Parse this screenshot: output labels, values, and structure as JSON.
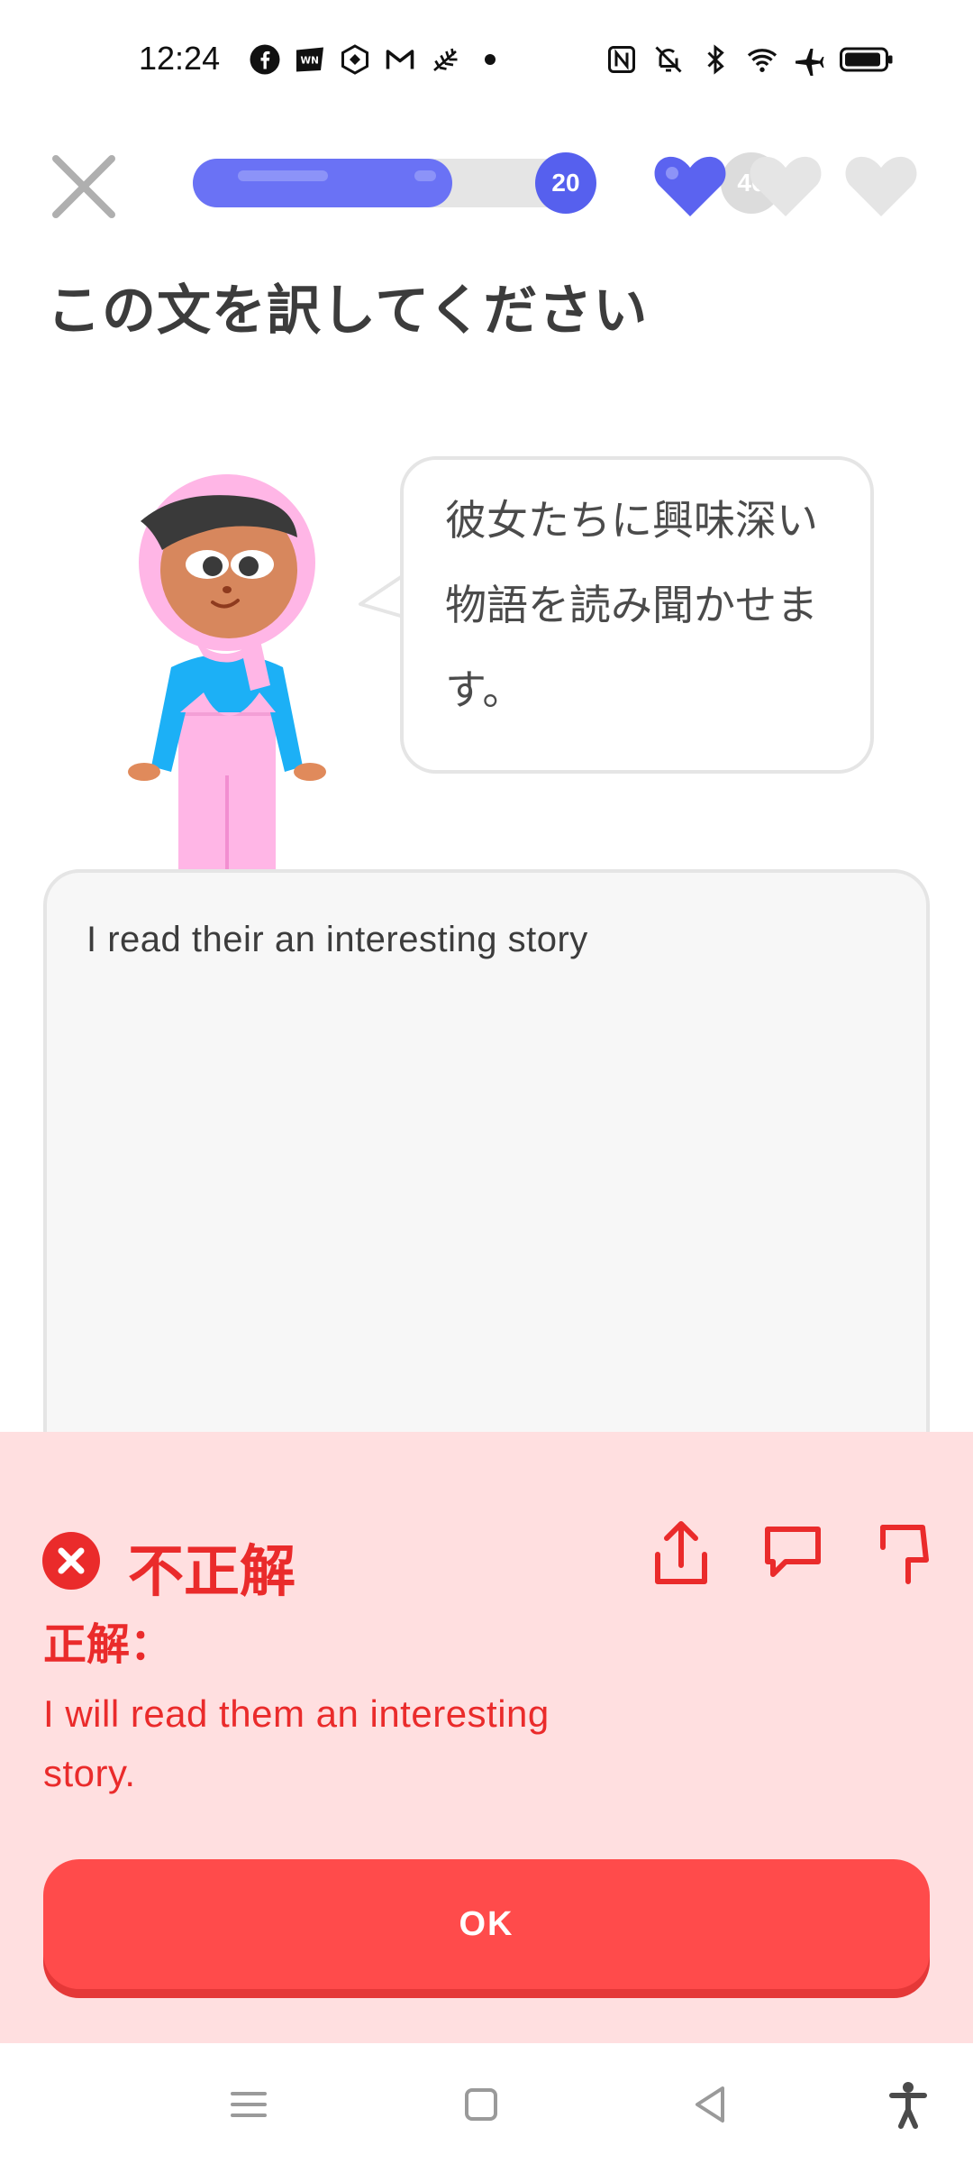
{
  "status_bar": {
    "time": "12:24",
    "left_icons": [
      "facebook-icon",
      "webtoon-icon",
      "sync-app-icon",
      "gmail-icon",
      "wheat-app-icon",
      "dot-icon"
    ],
    "right_icons": [
      "nfc-icon",
      "mute-icon",
      "bluetooth-icon",
      "wifi-icon",
      "airplane-icon",
      "battery-icon"
    ]
  },
  "header": {
    "progress": {
      "current_label": "20",
      "next_label": "40",
      "fraction": 0.66
    },
    "hearts": {
      "filled": 1,
      "total": 3
    }
  },
  "exercise": {
    "title": "この文を訳してください",
    "prompt_sentence": "彼女たちに興味深い物語を読み聞かせます。",
    "user_answer": "I read their an interesting story"
  },
  "feedback": {
    "title": "不正解",
    "correct_label": "正解：",
    "correct_answer": "I will read them an interesting story.",
    "ok_label": "OK"
  },
  "colors": {
    "accent": "#6a72f5",
    "error": "#ea2b2b",
    "error_bg": "#ffdfe0",
    "ok_button": "#ff4b4b"
  }
}
